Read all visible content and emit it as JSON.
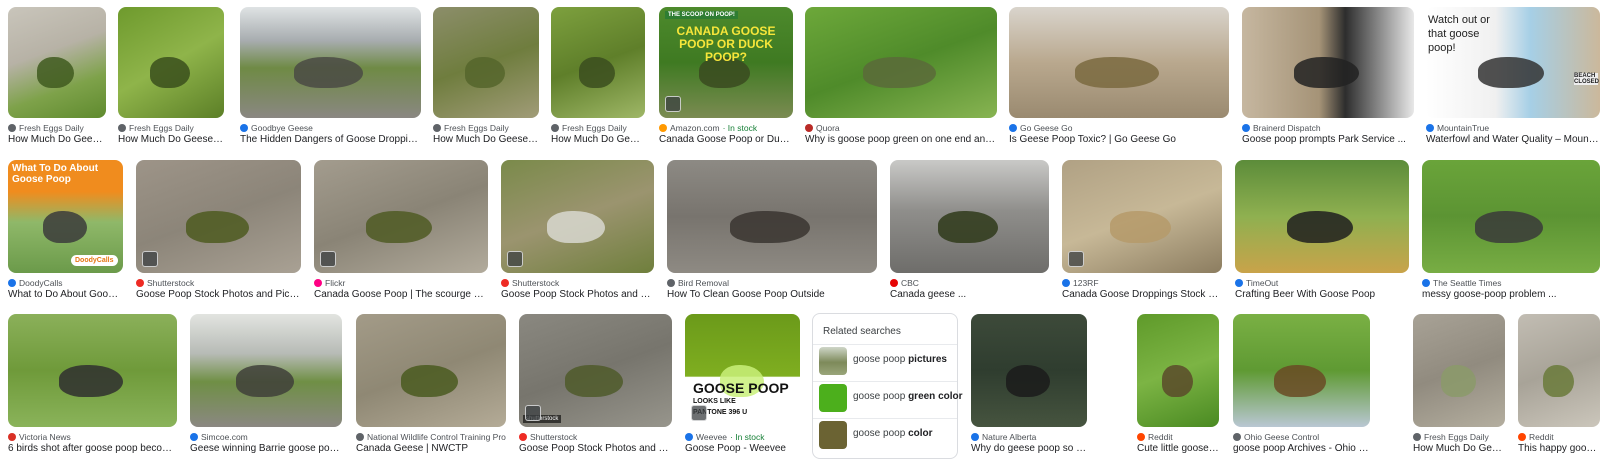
{
  "colors": {
    "instock": "#188038",
    "title": "#202124",
    "source": "#4d5156"
  },
  "rows": [
    {
      "tiles": [
        {
          "source": "Fresh Eggs Daily",
          "title": "How Much Do Geese ...",
          "icon": "globe-icon"
        },
        {
          "source": "Fresh Eggs Daily",
          "title": "How Much Do Geese A...",
          "icon": "globe-icon"
        },
        {
          "source": "Goodbye Geese",
          "title": "The Hidden Dangers of Goose Droppings ...",
          "icon": "site-icon"
        },
        {
          "source": "Fresh Eggs Daily",
          "title": "How Much Do Geese A...",
          "icon": "globe-icon"
        },
        {
          "source": "Fresh Eggs Daily",
          "title": "How Much Do Gees...",
          "icon": "globe-icon"
        },
        {
          "source": "Amazon.com",
          "stock": " · In stock",
          "title": "Canada Goose Poop or Duck ...",
          "icon": "amazon-icon",
          "overlay": {
            "top": "THE SCOOP ON POOP!",
            "main": "CANADA GOOSE POOP OR DUCK POOP?"
          }
        },
        {
          "source": "Quora",
          "title": "Why is goose poop green on one end and ...",
          "icon": "quora-icon"
        },
        {
          "source": "Go Geese Go",
          "title": "Is Geese Poop Toxic? | Go Geese Go",
          "icon": "site-icon"
        },
        {
          "source": "Brainerd Dispatch",
          "title": "Goose poop prompts Park Service ...",
          "icon": "site-icon"
        },
        {
          "source": "MountainTrue",
          "title": "Waterfowl and Water Quality – MountainTrue",
          "icon": "site-icon",
          "overlay": {
            "main": "Watch out or that goose poop!",
            "side": "BEACH CLOSED"
          }
        }
      ]
    },
    {
      "tiles": [
        {
          "source": "DoodyCalls",
          "title": "What to Do About Goose ...",
          "icon": "site-icon",
          "overlay": {
            "main": "What To Do About Goose Poop",
            "brand": "DoodyCalls"
          }
        },
        {
          "source": "Shutterstock",
          "title": "Goose Poop Stock Photos and Pictur...",
          "icon": "shutterstock-icon"
        },
        {
          "source": "Flickr",
          "title": "Canada Goose Poop | The scourge of ...",
          "icon": "flickr-icon"
        },
        {
          "source": "Shutterstock",
          "title": "Goose Poop Stock Photos and Pict...",
          "icon": "shutterstock-icon"
        },
        {
          "source": "Bird Removal",
          "title": "How To Clean Goose Poop Outside",
          "icon": "globe-icon"
        },
        {
          "source": "CBC",
          "title": "Canada geese ...",
          "icon": "cbc-icon"
        },
        {
          "source": "123RF",
          "title": "Canada Goose Droppings Stock Pho...",
          "icon": "site-icon"
        },
        {
          "source": "TimeOut",
          "title": "Crafting Beer With Goose Poop",
          "icon": "site-icon"
        },
        {
          "source": "The Seattle Times",
          "title": "messy goose-poop problem ...",
          "icon": "site-icon"
        }
      ]
    },
    {
      "tiles": [
        {
          "source": "Victoria News",
          "title": "6 birds shot after goose poop become...",
          "icon": "play-icon"
        },
        {
          "source": "Simcoe.com",
          "title": "Geese winning Barrie goose poop ...",
          "icon": "site-icon"
        },
        {
          "source": "National Wildlife Control Training Pro...",
          "title": "Canada Geese | NWCTP",
          "icon": "globe-icon"
        },
        {
          "source": "Shutterstock",
          "title": "Goose Poop Stock Photos and Pict...",
          "icon": "shutterstock-icon",
          "overlay": {
            "wm": "shutterstock"
          }
        },
        {
          "source": "Weevee",
          "stock": " · In stock",
          "title": "Goose Poop - Weevee",
          "icon": "site-icon",
          "overlay": {
            "main": "GOOSE POOP",
            "sub": "LOOKS LIKE",
            "pantone": "PANTONE 396 U"
          }
        },
        {
          "source": "Nature Alberta",
          "title": "Why do geese poop so much? - ...",
          "icon": "site-icon"
        },
        {
          "source": "Reddit",
          "title": "Cute little goose po...",
          "icon": "reddit-icon"
        },
        {
          "source": "Ohio Geese Control",
          "title": "goose poop Archives - Ohio Geese Co...",
          "icon": "globe-icon"
        },
        {
          "source": "Fresh Eggs Daily",
          "title": "How Much Do Gees...",
          "icon": "globe-icon"
        },
        {
          "source": "Reddit",
          "title": "This happy goose po...",
          "icon": "reddit-icon"
        }
      ]
    }
  ],
  "related": {
    "heading": "Related searches",
    "items": [
      {
        "prefix": "goose poop ",
        "bold": "pictures"
      },
      {
        "prefix": "goose poop ",
        "bold": "green color"
      },
      {
        "prefix": "goose poop ",
        "bold": "color"
      }
    ]
  }
}
